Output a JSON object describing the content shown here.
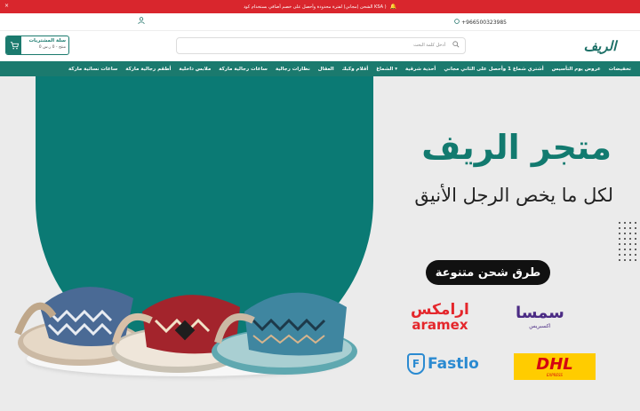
{
  "announcement": {
    "text": "الشحن (مجاني) لفترة محدودة وأحصل على خصم أضافي بستخدام كود KSA )",
    "close_icon": "×",
    "bell_icon": "bell-icon"
  },
  "topbar": {
    "phone": "+966500323985",
    "phone_icon": "whatsapp-icon",
    "user_icon": "user-icon"
  },
  "header": {
    "logo_text": "الريف",
    "search_placeholder": "أدخل كلمة البحث",
    "cart_title": "سلة المشتريات",
    "cart_summary": "0 منتج - 0 ر.س"
  },
  "nav": {
    "items": [
      "تخفيضات",
      "عروض يوم التأسيس",
      "أشتري شماغ 1 وأحصل على الثاني مجاني",
      "أحذية شرقية",
      "الشماغ",
      "أقلام وكبك",
      "العقال",
      "نظارات رجالية",
      "ساعات رجالية ماركة",
      "ملابس داخلية",
      "أطقم رجالية ماركة",
      "ساعات نسائية ماركة"
    ]
  },
  "hero": {
    "title": "متجر الريف",
    "subtitle": "لكل ما يخص الرجل الأنيق",
    "shipping_label": "طرق شحن متنوعة",
    "carriers": {
      "aramex_ar": "ارامكس",
      "aramex_en": "aramex",
      "smsa_logo": "سمسا",
      "smsa_ar": "اكسبريس",
      "fastlo": "Fastlo",
      "dhl": "DHL",
      "dhl_sub": "EXPRESS"
    }
  },
  "colors": {
    "brand_green": "#1b7a6e",
    "announce_red": "#d9262d",
    "aramex_red": "#e4262b",
    "smsa_purple": "#4b2b84",
    "fastlo_blue": "#2a8ad1",
    "dhl_yellow": "#ffcc00"
  }
}
